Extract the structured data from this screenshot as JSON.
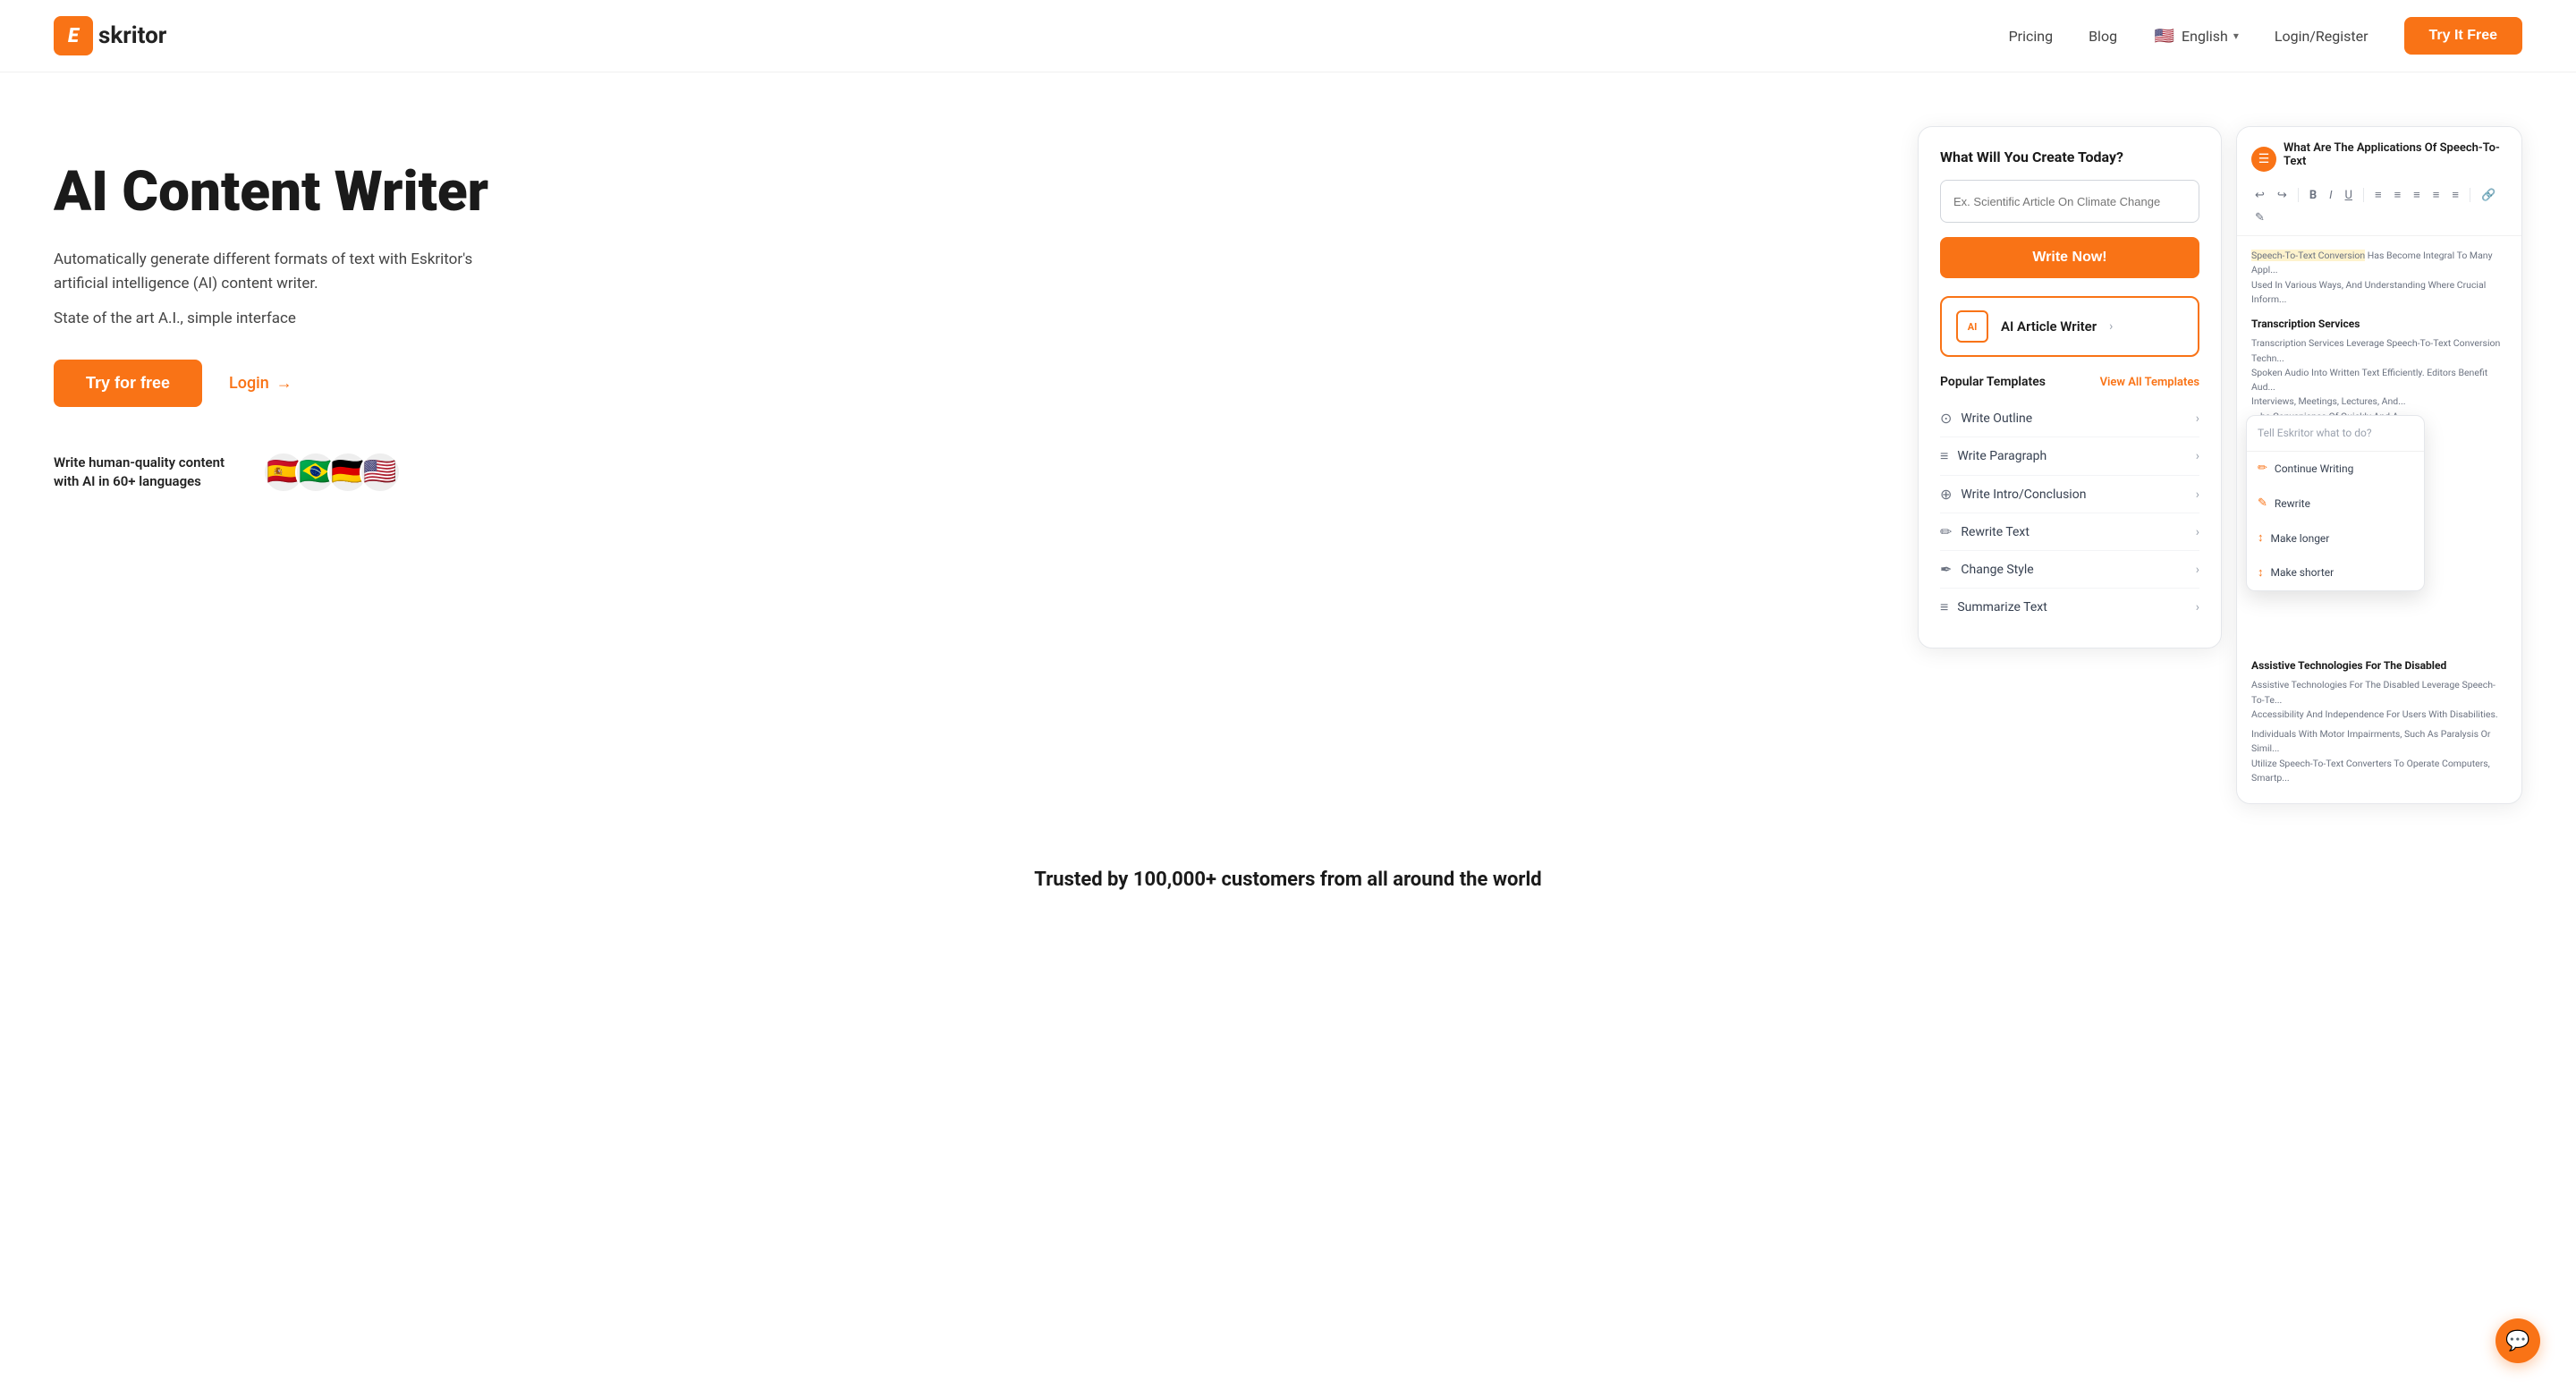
{
  "header": {
    "logo_letter": "E",
    "logo_name": "skritor",
    "nav": {
      "pricing": "Pricing",
      "blog": "Blog",
      "language": "English",
      "login_register": "Login/Register",
      "try_free": "Try It Free"
    }
  },
  "hero": {
    "title": "AI Content Writer",
    "desc": "Automatically generate different formats of text with Eskritor's artificial intelligence (AI) content writer.",
    "sub": "State of the art A.I., simple interface",
    "cta_primary": "Try for free",
    "cta_secondary": "Login",
    "languages_text": "Write human-quality content with AI in 60+ languages",
    "flags": [
      "🇪🇸",
      "🇧🇷",
      "🇩🇪",
      "🇺🇸"
    ]
  },
  "card1": {
    "title": "What Will You Create Today?",
    "input_placeholder": "Ex. Scientific Article On Climate Change",
    "write_now": "Write Now!",
    "ai_article_label": "AI Article Writer",
    "ai_article_icon_text": "AI",
    "popular_templates": "Popular Templates",
    "view_all": "View All Templates",
    "templates": [
      {
        "icon": "⊙",
        "label": "Write Outline"
      },
      {
        "icon": "≡",
        "label": "Write Paragraph"
      },
      {
        "icon": "⊕",
        "label": "Write Intro/Conclusion"
      },
      {
        "icon": "✏",
        "label": "Rewrite Text"
      },
      {
        "icon": "✒",
        "label": "Change Style"
      },
      {
        "icon": "≡",
        "label": "Summarize Text"
      }
    ]
  },
  "card2": {
    "title": "What Are The Applications Of Speech-To-Text",
    "toolbar_items": [
      "↩",
      "↪",
      "B",
      "I",
      "U",
      "≡",
      "≡",
      "≡",
      "≡",
      "≡",
      "≡",
      "≡",
      "🔗",
      "✎"
    ],
    "intro_text": "Speech-To-Text Conversion Has Become Integral To Many Appl... Used In Various Ways, And Understanding Where Crucial Inform...",
    "section1_title": "Transcription Services",
    "section1_text": "Transcription Services Leverage Speech-To-Text Conversion Techn... Spoken Audio Into Written Text Efficiently. Editors Benefit Aud... Interviews, Meetings, Lectures, And... he Convenience Of Quickly And A... nt, Saving Time And Effort, Pro... ly On Transcription Services To... earch Findings,... ion Services To Generate Simp... Interactions For Documentation...",
    "section2_title": "Assistive Technologies For The Disabled",
    "section2_text1": "Assistive Technologies For The Disabled Leverage Speech-To-Te... Accessibility And Independence For Users With Disabilities.",
    "section2_text2": "Individuals With Motor Impairments, Such As Paralysis Or Simil... Utilize Speech-To-Text Converters To Operate Computers, Smartp..."
  },
  "dropdown": {
    "input_placeholder": "Tell Eskritor what to do?",
    "items": [
      {
        "icon": "✏",
        "label": "Continue Writing"
      },
      {
        "icon": "✎",
        "label": "Rewrite"
      },
      {
        "icon": "↕",
        "label": "Make longer"
      },
      {
        "icon": "↕",
        "label": "Make shorter"
      }
    ]
  },
  "trusted": {
    "text": "Trusted by 100,000+ customers from all around the world"
  },
  "chat": {
    "icon": "💬"
  }
}
